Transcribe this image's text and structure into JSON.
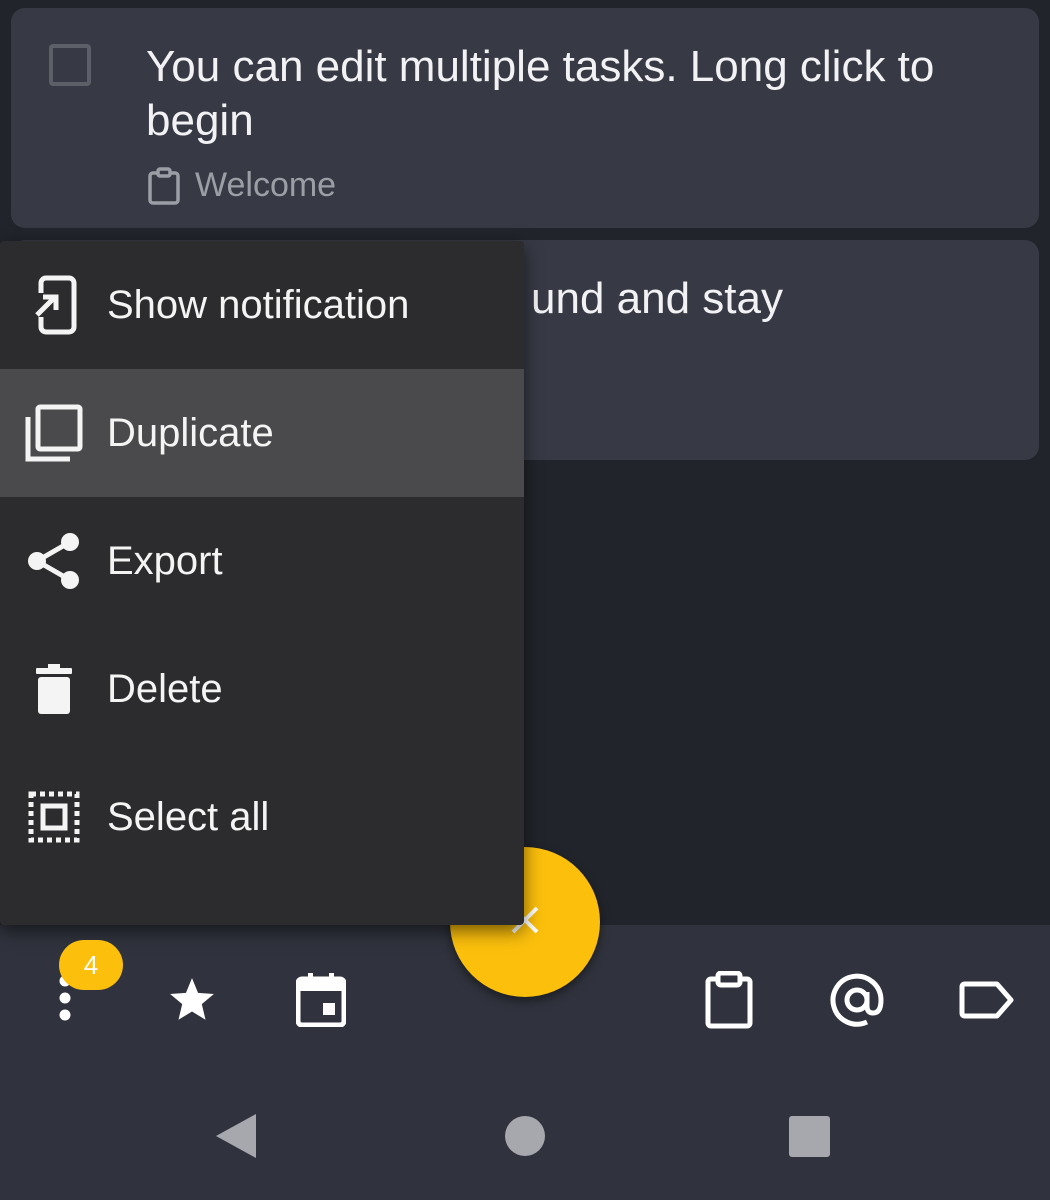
{
  "tasks": [
    {
      "title": "You can edit multiple tasks. Long click to begin",
      "list": "Welcome"
    },
    {
      "title_visible_fragment": "und and stay"
    }
  ],
  "menu": {
    "items": [
      {
        "label": "Show notification",
        "icon": "notification-icon"
      },
      {
        "label": "Duplicate",
        "icon": "duplicate-icon",
        "highlighted": true
      },
      {
        "label": "Export",
        "icon": "share-icon"
      },
      {
        "label": "Delete",
        "icon": "trash-icon"
      },
      {
        "label": "Select all",
        "icon": "select-all-icon"
      }
    ]
  },
  "bottom_bar": {
    "overflow_badge": "4",
    "icons": [
      "more-vert-icon",
      "star-icon",
      "calendar-icon",
      "clipboard-icon",
      "at-icon",
      "label-icon"
    ]
  },
  "fab": {
    "icon": "close-icon"
  },
  "colors": {
    "background": "#21242b",
    "card": "#373a45",
    "menu": "#2c2c2e",
    "menu_highlight": "#4a4a4c",
    "accent": "#fbbf0c",
    "bottom_bar": "#30333d"
  }
}
